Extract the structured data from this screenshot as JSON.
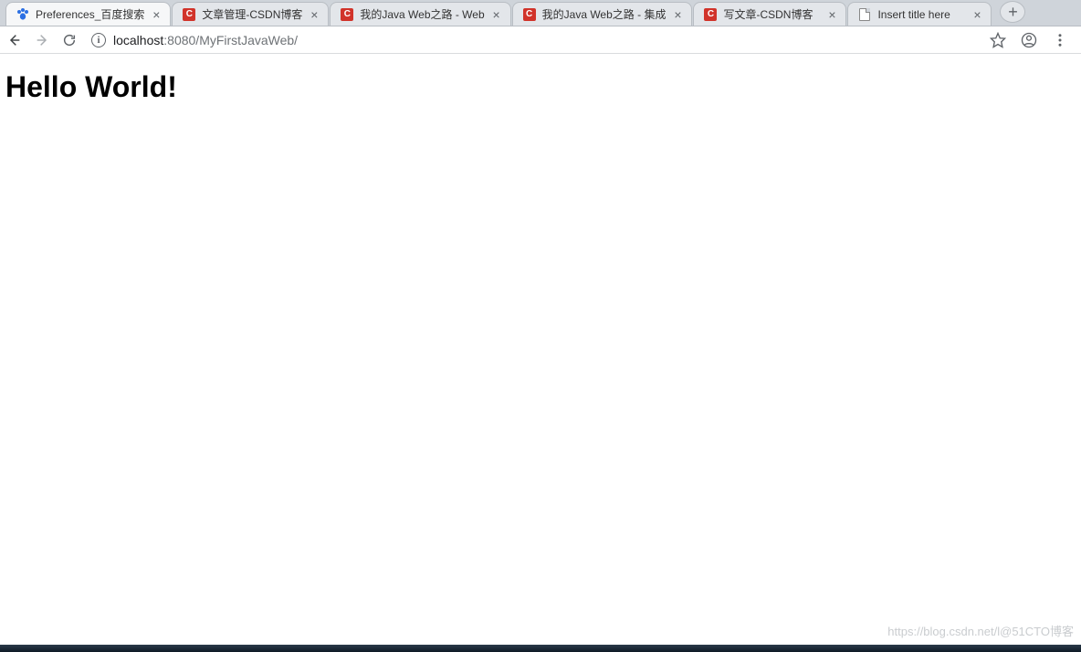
{
  "window_controls": {
    "minimize": "minimize-icon",
    "maximize": "maximize-icon",
    "close": "close-icon"
  },
  "tabs": [
    {
      "label": "Preferences_百度搜索",
      "favicon": "baidu-icon",
      "active": true
    },
    {
      "label": "文章管理-CSDN博客",
      "favicon": "csdn-icon",
      "active": false
    },
    {
      "label": "我的Java Web之路 - Web",
      "favicon": "csdn-icon",
      "active": false
    },
    {
      "label": "我的Java Web之路 - 集成",
      "favicon": "csdn-icon",
      "active": false
    },
    {
      "label": "写文章-CSDN博客",
      "favicon": "csdn-icon",
      "active": false
    },
    {
      "label": "Insert title here",
      "favicon": "page-icon",
      "active": false
    }
  ],
  "new_tab_label": "+",
  "toolbar": {
    "back_icon": "arrow-left-icon",
    "forward_icon": "arrow-right-icon",
    "reload_icon": "reload-icon",
    "info_icon": "info-icon",
    "info_glyph": "i",
    "url_host": "localhost",
    "url_rest": ":8080/MyFirstJavaWeb/",
    "star_icon": "star-icon",
    "account_icon": "account-icon",
    "menu_icon": "more-vert-icon"
  },
  "page": {
    "heading": "Hello World!"
  },
  "watermark": "https://blog.csdn.net/l@51CTO博客"
}
